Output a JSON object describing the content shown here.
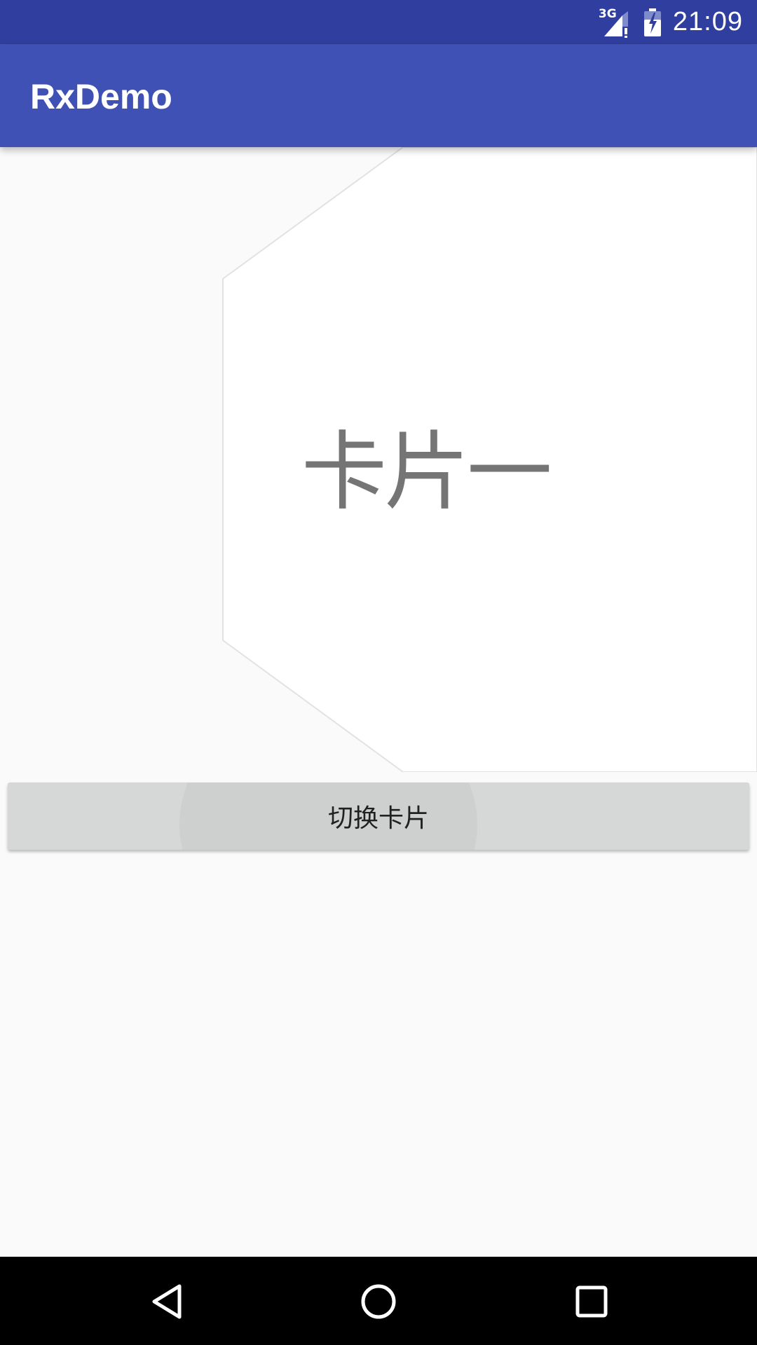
{
  "status_bar": {
    "network_label": "3G",
    "time": "21:09",
    "icons": [
      "signal-icon",
      "battery-charging-icon"
    ]
  },
  "app_bar": {
    "title": "RxDemo"
  },
  "card": {
    "label": "卡片一"
  },
  "switch_button": {
    "label": "切换卡片"
  },
  "nav_bar": {
    "icons": [
      "back-icon",
      "home-icon",
      "recents-icon"
    ]
  },
  "colors": {
    "status_bar": "#303f9f",
    "app_bar": "#3f51b5",
    "background": "#fafafa",
    "card": "#ffffff",
    "card_text": "#757575",
    "button": "#d6d7d7",
    "nav_bar": "#000000"
  }
}
